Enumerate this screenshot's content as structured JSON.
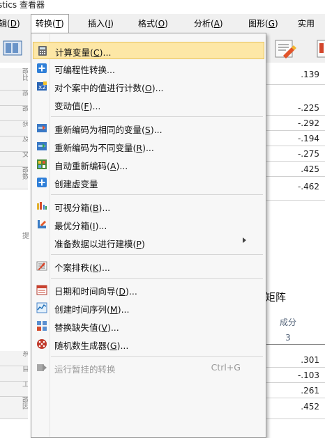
{
  "window": {
    "title": "stics 查看器"
  },
  "menubar": {
    "items": [
      {
        "label": "辑(",
        "key": "D",
        "suffix": ")"
      },
      {
        "label": "转换(",
        "key": "T",
        "suffix": ")"
      },
      {
        "label": "插入(",
        "key": "I",
        "suffix": ")"
      },
      {
        "label": "格式(",
        "key": "O",
        "suffix": ")"
      },
      {
        "label": "分析(",
        "key": "A",
        "suffix": ")"
      },
      {
        "label": "图形(",
        "key": "G",
        "suffix": ")"
      },
      {
        "label": "实用",
        "key": "",
        "suffix": ""
      }
    ]
  },
  "menu": {
    "items": [
      {
        "text": "计算变量(",
        "key": "C",
        "after": ")...",
        "icon": "calculator-icon",
        "highlight": true
      },
      {
        "text": "可编程性转换...",
        "key": "",
        "after": "",
        "icon": "plus-icon"
      },
      {
        "text": "对个案中的值进行计数(",
        "key": "O",
        "after": ")...",
        "icon": "count-values-icon"
      },
      {
        "text": "变动值(",
        "key": "F",
        "after": ")...",
        "icon": ""
      },
      {
        "text": "重新编码为相同的变量(",
        "key": "S",
        "after": ")...",
        "icon": "recode-same-icon"
      },
      {
        "text": "重新编码为不同变量(",
        "key": "R",
        "after": ")...",
        "icon": "recode-different-icon"
      },
      {
        "text": "自动重新编码(",
        "key": "A",
        "after": ")...",
        "icon": "automatic-recode-icon"
      },
      {
        "text": "创建虚变量",
        "key": "",
        "after": "",
        "icon": "plus-icon"
      },
      {
        "text": "可视分箱(",
        "key": "B",
        "after": ")...",
        "icon": "visual-binning-icon"
      },
      {
        "text": "最优分箱(",
        "key": "I",
        "after": ")...",
        "icon": "optimal-binning-icon"
      },
      {
        "text": "准备数据以进行建模(",
        "key": "P",
        "after": ")",
        "icon": "",
        "submenu": true
      },
      {
        "text": "个案排秩(",
        "key": "K",
        "after": ")...",
        "icon": "rank-cases-icon"
      },
      {
        "text": "日期和时间向导(",
        "key": "D",
        "after": ")...",
        "icon": "calendar-icon"
      },
      {
        "text": "创建时间序列(",
        "key": "M",
        "after": ")...",
        "icon": "time-series-icon"
      },
      {
        "text": "替换缺失值(",
        "key": "V",
        "after": ")...",
        "icon": "replace-missing-icon"
      },
      {
        "text": "随机数生成器(",
        "key": "G",
        "after": ")...",
        "icon": "random-number-icon"
      },
      {
        "text": "运行暂挂的转换",
        "key": "",
        "after": "",
        "icon": "run-pending-icon",
        "disabled": true,
        "shortcut": "Ctrl+G"
      }
    ]
  },
  "background": {
    "top_values": [
      ".139",
      "-.225",
      "-.292",
      "-.194",
      "-.275",
      ".425",
      "-.462"
    ],
    "left_labels_top": [
      "故比",
      "故",
      "故",
      "获",
      "及",
      "文",
      "故数"
    ],
    "note_label": "提",
    "matrix_title": "矩阵",
    "component_header": "成分",
    "component_number": "3",
    "bottom_values": [
      ".301",
      "-.103",
      ".261",
      ".452"
    ],
    "left_labels_bottom": [
      "系",
      "自",
      "工",
      "故因"
    ]
  }
}
